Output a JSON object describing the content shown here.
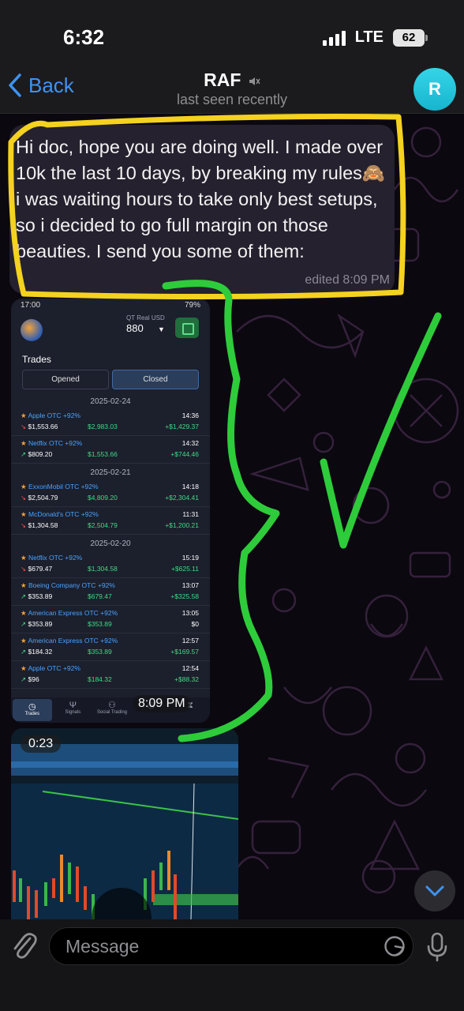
{
  "status_bar": {
    "time": "6:32",
    "network": "LTE",
    "battery": "62"
  },
  "header": {
    "back_label": "Back",
    "title": "RAF",
    "subtitle": "last seen recently",
    "avatar_initial": "R"
  },
  "message": {
    "text": "Hi doc, hope you are doing well. I made over 10k the last 10 days, by breaking my rules🙈 i was waiting hours to take only best setups, so i decided to go full margin on those beauties. I send you some of them:",
    "meta": "edited 8:09 PM"
  },
  "photo": {
    "time": "8:09 PM",
    "phone_status": {
      "time": "17:00",
      "battery": "79%"
    },
    "account_label": "QT Real  USD",
    "balance": "880",
    "trades_title": "Trades",
    "toggle": {
      "opened": "Opened",
      "closed": "Closed"
    },
    "groups": [
      {
        "date": "2025-02-24",
        "trades": [
          {
            "asset": "Apple OTC +92%",
            "time": "14:36",
            "investment": "$1,553.66",
            "direction": "down",
            "payout": "$2,983.03",
            "profit": "+$1,429.37"
          },
          {
            "asset": "Netflix OTC +92%",
            "time": "14:32",
            "investment": "$809.20",
            "direction": "up",
            "payout": "$1,553.66",
            "profit": "+$744.46"
          }
        ]
      },
      {
        "date": "2025-02-21",
        "trades": [
          {
            "asset": "ExxonMobil OTC +92%",
            "time": "14:18",
            "investment": "$2,504.79",
            "direction": "down",
            "payout": "$4,809.20",
            "profit": "+$2,304.41"
          },
          {
            "asset": "McDonald's OTC +92%",
            "time": "11:31",
            "investment": "$1,304.58",
            "direction": "down",
            "payout": "$2,504.79",
            "profit": "+$1,200.21"
          }
        ]
      },
      {
        "date": "2025-02-20",
        "trades": [
          {
            "asset": "Netflix OTC +92%",
            "time": "15:19",
            "investment": "$679.47",
            "direction": "down",
            "payout": "$1,304.58",
            "profit": "+$625.11"
          },
          {
            "asset": "Boeing Company OTC +92%",
            "time": "13:07",
            "investment": "$353.89",
            "direction": "up",
            "payout": "$679.47",
            "profit": "+$325.58"
          },
          {
            "asset": "American Express OTC +92%",
            "time": "13:05",
            "investment": "$353.89",
            "direction": "up",
            "payout": "$353.89",
            "profit": "$0"
          },
          {
            "asset": "American Express OTC +92%",
            "time": "12:57",
            "investment": "$184.32",
            "direction": "up",
            "payout": "$353.89",
            "profit": "+$169.57"
          },
          {
            "asset": "Apple OTC +92%",
            "time": "12:54",
            "investment": "$96",
            "direction": "up",
            "payout": "$184.32",
            "profit": "+$88.32"
          }
        ]
      }
    ],
    "tabs": [
      "Trades",
      "Signals",
      "Social Trading",
      "",
      ""
    ]
  },
  "video": {
    "duration": "0:23"
  },
  "input": {
    "placeholder": "Message"
  },
  "colors": {
    "accent_blue": "#3d93f5",
    "bubble": "#26212e",
    "highlight_yellow": "#f4d21f",
    "annotation_green": "#2ecc3a"
  }
}
